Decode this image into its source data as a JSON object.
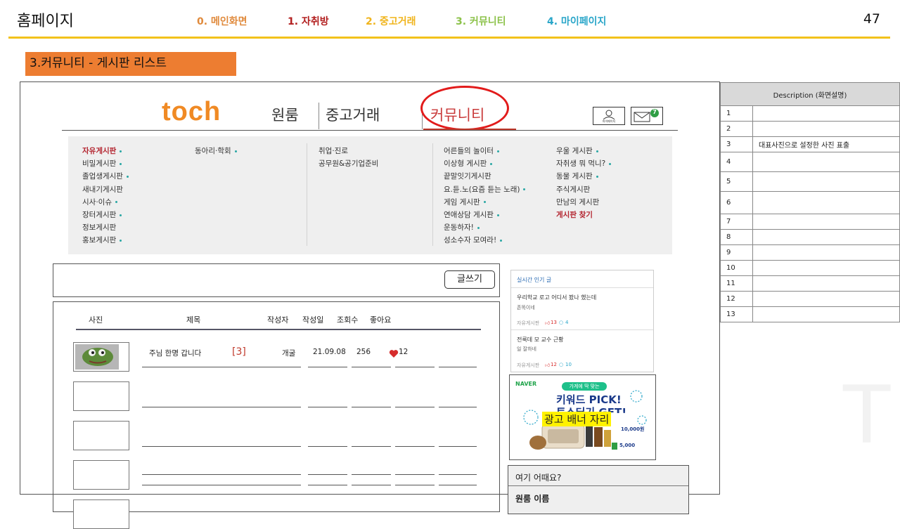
{
  "slide": {
    "title": "홈페이지",
    "page_number": "47",
    "nav": [
      {
        "label": "0. 메인화면",
        "color": "#e08a3c"
      },
      {
        "label": "1. 자취방",
        "color": "#b21f1f"
      },
      {
        "label": "2. 중고거래",
        "color": "#f0b41c"
      },
      {
        "label": "3. 커뮤니티",
        "color": "#8cc24a"
      },
      {
        "label": "4. 마이페이지",
        "color": "#2aa6c9"
      }
    ],
    "section_label": "3.커뮤니티 - 게시판 리스트",
    "accent_color": "#f2c21b",
    "section_color": "#ed7d31"
  },
  "site": {
    "logo": "toch",
    "tabs": [
      "원룸",
      "중고거래",
      "커뮤니티"
    ],
    "mypage_label": "마이페이지",
    "mail_badge": "7"
  },
  "board_menu": {
    "col1": [
      "자유게시판",
      "비밀게시판",
      "졸업생게시판",
      "새내기게시판",
      "시사·이슈",
      "장터게시판",
      "정보게시판",
      "홍보게시판"
    ],
    "col2": [
      "동아리·학회"
    ],
    "col3": [
      "취업·진로",
      "공무원&공기업준비"
    ],
    "col4": [
      "어른들의 놀이터",
      "이상형 게시판",
      "끝말잇기게시판",
      "요.듣.노(요즘 듣는 노래)",
      "게임 게시판",
      "연애상담 게시판",
      "운동하자!",
      "성소수자 모여라!"
    ],
    "col5": [
      "우울 게시판",
      "자취생 뭐 먹니?",
      "동물 게시판",
      "주식게시판",
      "만남의 게시판",
      "게시판 찾기"
    ]
  },
  "write_button": "글쓰기",
  "list": {
    "headers": [
      "사진",
      "제목",
      "작성자",
      "작성일",
      "조회수",
      "좋아요"
    ],
    "rows": [
      {
        "title": "주님 한명 갑니다",
        "comments": "[3]",
        "author": "개굴",
        "date": "21.09.08",
        "views": "256",
        "likes": "12"
      }
    ]
  },
  "popular": {
    "heading": "실시간 인기 글",
    "posts": [
      {
        "title": "우리학교 로고 어디서 봤나 했는데",
        "sub": "존똑이네",
        "board": "자유게시판",
        "likes": "13",
        "comments": "4"
      },
      {
        "title": "전룩데 모 교수 근황",
        "sub": "일 잘하네",
        "board": "자유게시판",
        "likes": "12",
        "comments": "10"
      }
    ]
  },
  "ad": {
    "brand": "NAVER",
    "pill": "가게에 딱 맞는",
    "headline": "키워드 PICK!",
    "headline2": "토스터기 GET!",
    "overlay": "광고 배너 자리",
    "price1": "10,000원",
    "price2": "5,000"
  },
  "recommend": {
    "heading": "여기 어때요?",
    "item": "원룸 이름"
  },
  "description": {
    "header": "Description (화면설명)",
    "rows": [
      {
        "num": "1",
        "text": ""
      },
      {
        "num": "2",
        "text": ""
      },
      {
        "num": "3",
        "text": "대표사진으로 설정한 사진 표출"
      },
      {
        "num": "4",
        "text": ""
      },
      {
        "num": "5",
        "text": ""
      },
      {
        "num": "6",
        "text": ""
      },
      {
        "num": "7",
        "text": ""
      },
      {
        "num": "8",
        "text": ""
      },
      {
        "num": "9",
        "text": ""
      },
      {
        "num": "10",
        "text": ""
      },
      {
        "num": "11",
        "text": ""
      },
      {
        "num": "12",
        "text": ""
      },
      {
        "num": "13",
        "text": ""
      }
    ]
  }
}
